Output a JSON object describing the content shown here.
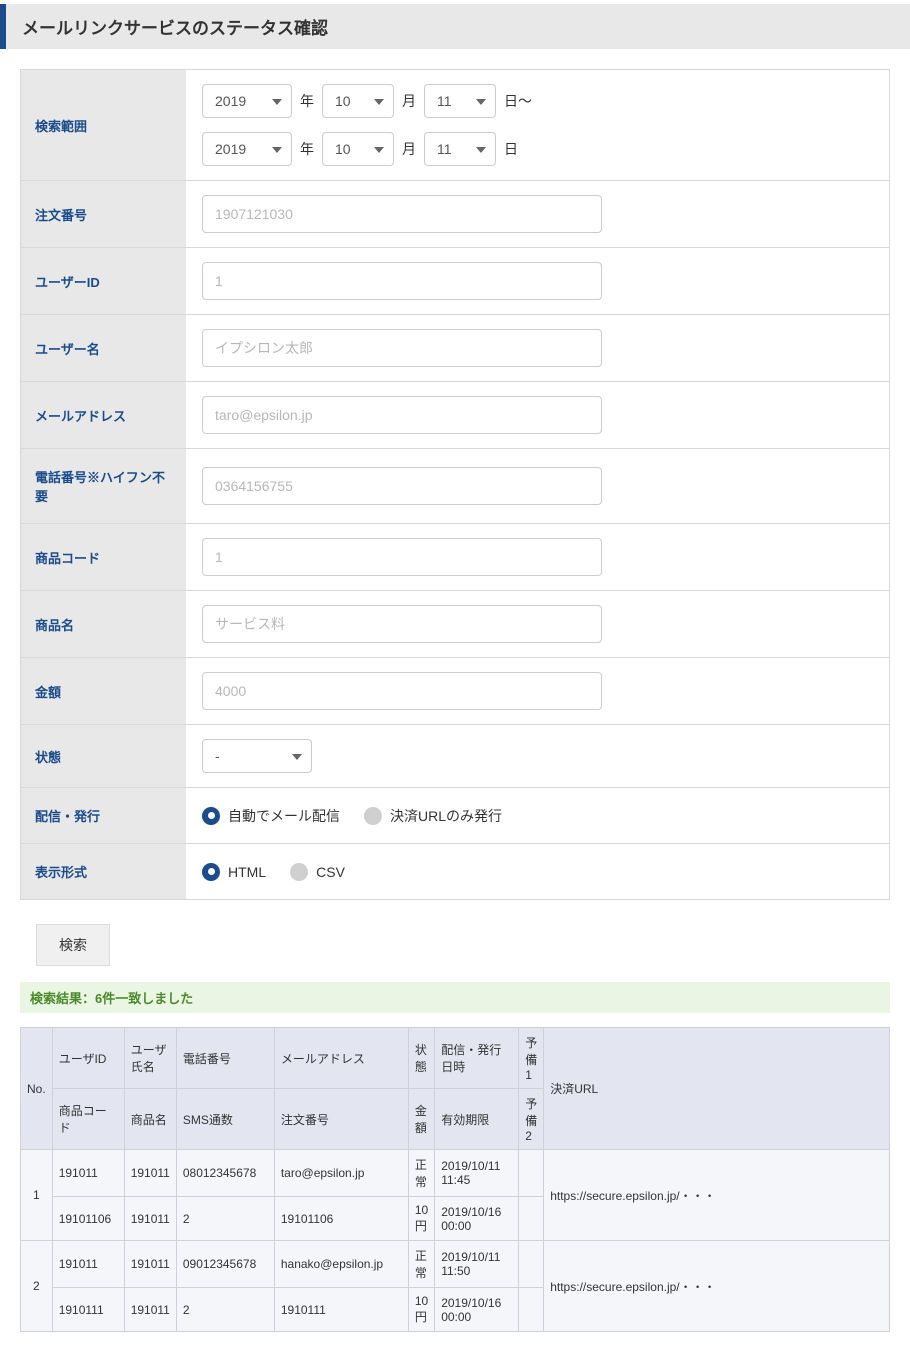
{
  "page_title": "メールリンクサービスのステータス確認",
  "labels": {
    "search_range": "検索範囲",
    "order_no": "注文番号",
    "user_id": "ユーザーID",
    "user_name": "ユーザー名",
    "email": "メールアドレス",
    "phone": "電話番号※ハイフン不要",
    "product_code": "商品コード",
    "product_name": "商品名",
    "amount": "金額",
    "status": "状態",
    "delivery": "配信・発行",
    "display_format": "表示形式"
  },
  "date_from": {
    "year": "2019",
    "month": "10",
    "day": "11"
  },
  "date_to": {
    "year": "2019",
    "month": "10",
    "day": "11"
  },
  "date_units": {
    "year": "年",
    "month": "月",
    "day": "日",
    "tilde": "日～"
  },
  "placeholders": {
    "order_no": "1907121030",
    "user_id": "1",
    "user_name": "イプシロン太郎",
    "email": "taro@epsilon.jp",
    "phone": "0364156755",
    "product_code": "1",
    "product_name": "サービス料",
    "amount": "4000"
  },
  "status_value": "-",
  "delivery_options": [
    {
      "label": "自動でメール配信",
      "selected": true
    },
    {
      "label": "決済URLのみ発行",
      "selected": false
    }
  ],
  "format_options": [
    {
      "label": "HTML",
      "selected": true
    },
    {
      "label": "CSV",
      "selected": false
    }
  ],
  "search_button": "検索",
  "result_message": "検索結果：6件一致しました",
  "table": {
    "headers": {
      "no": "No.",
      "user_id": "ユーザID",
      "user_name": "ユーザ氏名",
      "phone": "電話番号",
      "email": "メールアドレス",
      "status": "状態",
      "send_date": "配信・発行日時",
      "yobi1": "予備1",
      "url": "決済URL",
      "product_code": "商品コード",
      "product_name": "商品名",
      "sms_count": "SMS通数",
      "order_no": "注文番号",
      "amount": "金額",
      "expiry": "有効期限",
      "yobi2": "予備2"
    },
    "rows": [
      {
        "no": "1",
        "r1": {
          "user_id": "191011",
          "user_name": "191011",
          "phone": "08012345678",
          "email": "taro@epsilon.jp",
          "status": "正常",
          "send_date": "2019/10/11 11:45",
          "yobi1": ""
        },
        "r2": {
          "product_code": "19101106",
          "product_name": "191011",
          "sms_count": "2",
          "order_no": "19101106",
          "amount": "10円",
          "expiry": "2019/10/16 00:00",
          "yobi2": ""
        },
        "url": "https://secure.epsilon.jp/・・・"
      },
      {
        "no": "2",
        "r1": {
          "user_id": "191011",
          "user_name": "191011",
          "phone": "09012345678",
          "email": "hanako@epsilon.jp",
          "status": "正常",
          "send_date": "2019/10/11 11:50",
          "yobi1": ""
        },
        "r2": {
          "product_code": "1910111",
          "product_name": "191011",
          "sms_count": "2",
          "order_no": "1910111",
          "amount": "10円",
          "expiry": "2019/10/16 00:00",
          "yobi2": ""
        },
        "url": "https://secure.epsilon.jp/・・・"
      }
    ]
  }
}
